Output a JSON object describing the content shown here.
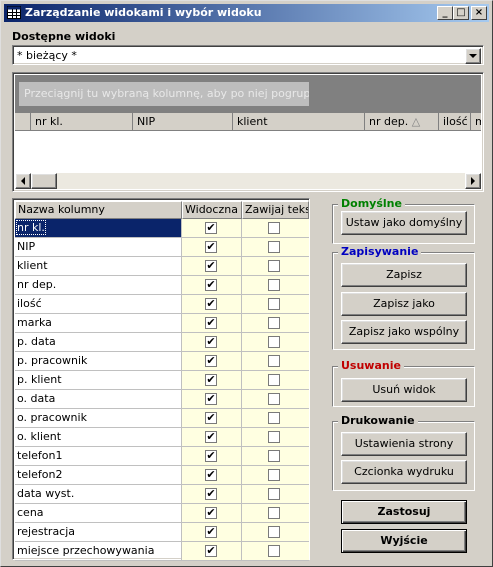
{
  "window": {
    "title": "Zarządzanie widokami i wybór widoku",
    "minimize": "_",
    "maximize": "□",
    "close": "×"
  },
  "available_views": {
    "label": "Dostępne widoki",
    "selected": "* bieżący *"
  },
  "grid_preview": {
    "group_placeholder": "Przeciągnij tu wybraną kolumnę, aby po niej pogrupować ...",
    "columns": [
      "nr kl.",
      "NIP",
      "klient",
      "nr dep.",
      "ilość",
      "m"
    ],
    "sort_indicator": "△"
  },
  "columns_table": {
    "headers": [
      "Nazwa kolumny",
      "Widoczna",
      "Zawijaj tekst"
    ],
    "rows": [
      {
        "name": "nr kl.",
        "visible": true,
        "wrap": false
      },
      {
        "name": "NIP",
        "visible": true,
        "wrap": false
      },
      {
        "name": "klient",
        "visible": true,
        "wrap": false
      },
      {
        "name": "nr dep.",
        "visible": true,
        "wrap": false
      },
      {
        "name": "ilość",
        "visible": true,
        "wrap": false
      },
      {
        "name": "marka",
        "visible": true,
        "wrap": false
      },
      {
        "name": "p. data",
        "visible": true,
        "wrap": false
      },
      {
        "name": "p. pracownik",
        "visible": true,
        "wrap": false
      },
      {
        "name": "p. klient",
        "visible": true,
        "wrap": false
      },
      {
        "name": "o. data",
        "visible": true,
        "wrap": false
      },
      {
        "name": "o. pracownik",
        "visible": true,
        "wrap": false
      },
      {
        "name": "o. klient",
        "visible": true,
        "wrap": false
      },
      {
        "name": "telefon1",
        "visible": true,
        "wrap": false
      },
      {
        "name": "telefon2",
        "visible": true,
        "wrap": false
      },
      {
        "name": "data wyst.",
        "visible": true,
        "wrap": false
      },
      {
        "name": "cena",
        "visible": true,
        "wrap": false
      },
      {
        "name": "rejestracja",
        "visible": true,
        "wrap": false
      },
      {
        "name": "miejsce przechowywania",
        "visible": true,
        "wrap": false
      }
    ],
    "selected_index": 0
  },
  "groups": {
    "defaults": {
      "title": "Domyślne",
      "color": "#008000",
      "buttons": [
        "Ustaw jako domyślny"
      ]
    },
    "saving": {
      "title": "Zapisywanie",
      "color": "#0000c0",
      "buttons": [
        "Zapisz",
        "Zapisz jako",
        "Zapisz jako wspólny"
      ]
    },
    "removing": {
      "title": "Usuwanie",
      "color": "#c00000",
      "buttons": [
        "Usuń widok"
      ]
    },
    "printing": {
      "title": "Drukowanie",
      "color": "#000000",
      "buttons": [
        "Ustawienia strony",
        "Czcionka wydruku"
      ]
    }
  },
  "actions": {
    "apply": "Zastosuj",
    "exit": "Wyjście"
  },
  "check_glyph": "✔"
}
